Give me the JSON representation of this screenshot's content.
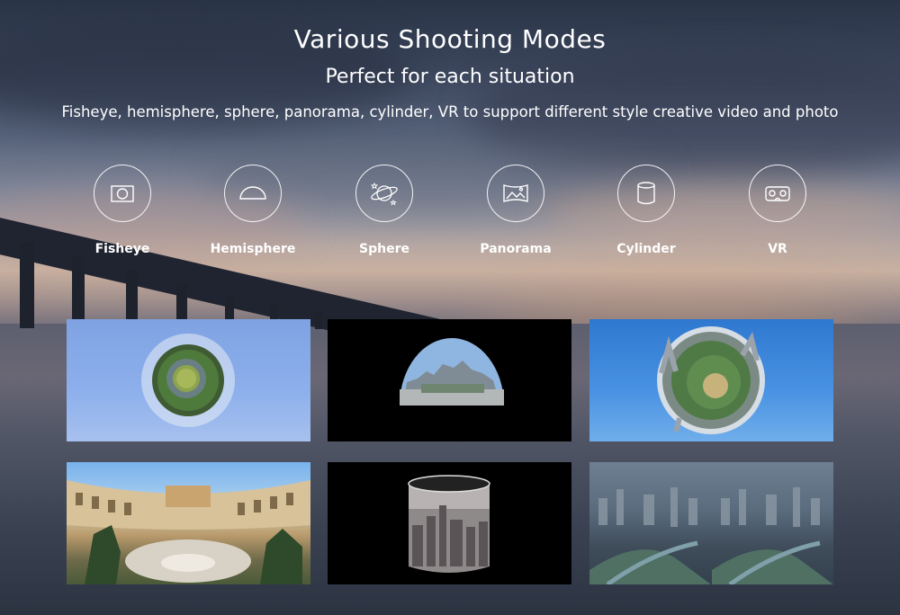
{
  "header": {
    "title": "Various Shooting Modes",
    "subtitle": "Perfect for each situation",
    "description": "Fisheye, hemisphere, sphere, panorama, cylinder, VR to support different style creative video and photo"
  },
  "modes": [
    {
      "label": "Fisheye",
      "icon": "fisheye-icon"
    },
    {
      "label": "Hemisphere",
      "icon": "hemisphere-icon"
    },
    {
      "label": "Sphere",
      "icon": "sphere-icon"
    },
    {
      "label": "Panorama",
      "icon": "panorama-icon"
    },
    {
      "label": "Cylinder",
      "icon": "cylinder-icon"
    },
    {
      "label": "VR",
      "icon": "vr-headset-icon"
    }
  ],
  "samples": [
    {
      "mode": "fisheye",
      "image": "tiny-planet-park"
    },
    {
      "mode": "hemisphere",
      "image": "hemisphere-city-square"
    },
    {
      "mode": "sphere",
      "image": "tiny-planet-city"
    },
    {
      "mode": "panorama",
      "image": "courtyard-panorama"
    },
    {
      "mode": "cylinder",
      "image": "cylinder-skyline"
    },
    {
      "mode": "vr",
      "image": "vr-split-city"
    }
  ],
  "colors": {
    "text": "#ffffff",
    "icon_stroke": "#ffffff"
  }
}
